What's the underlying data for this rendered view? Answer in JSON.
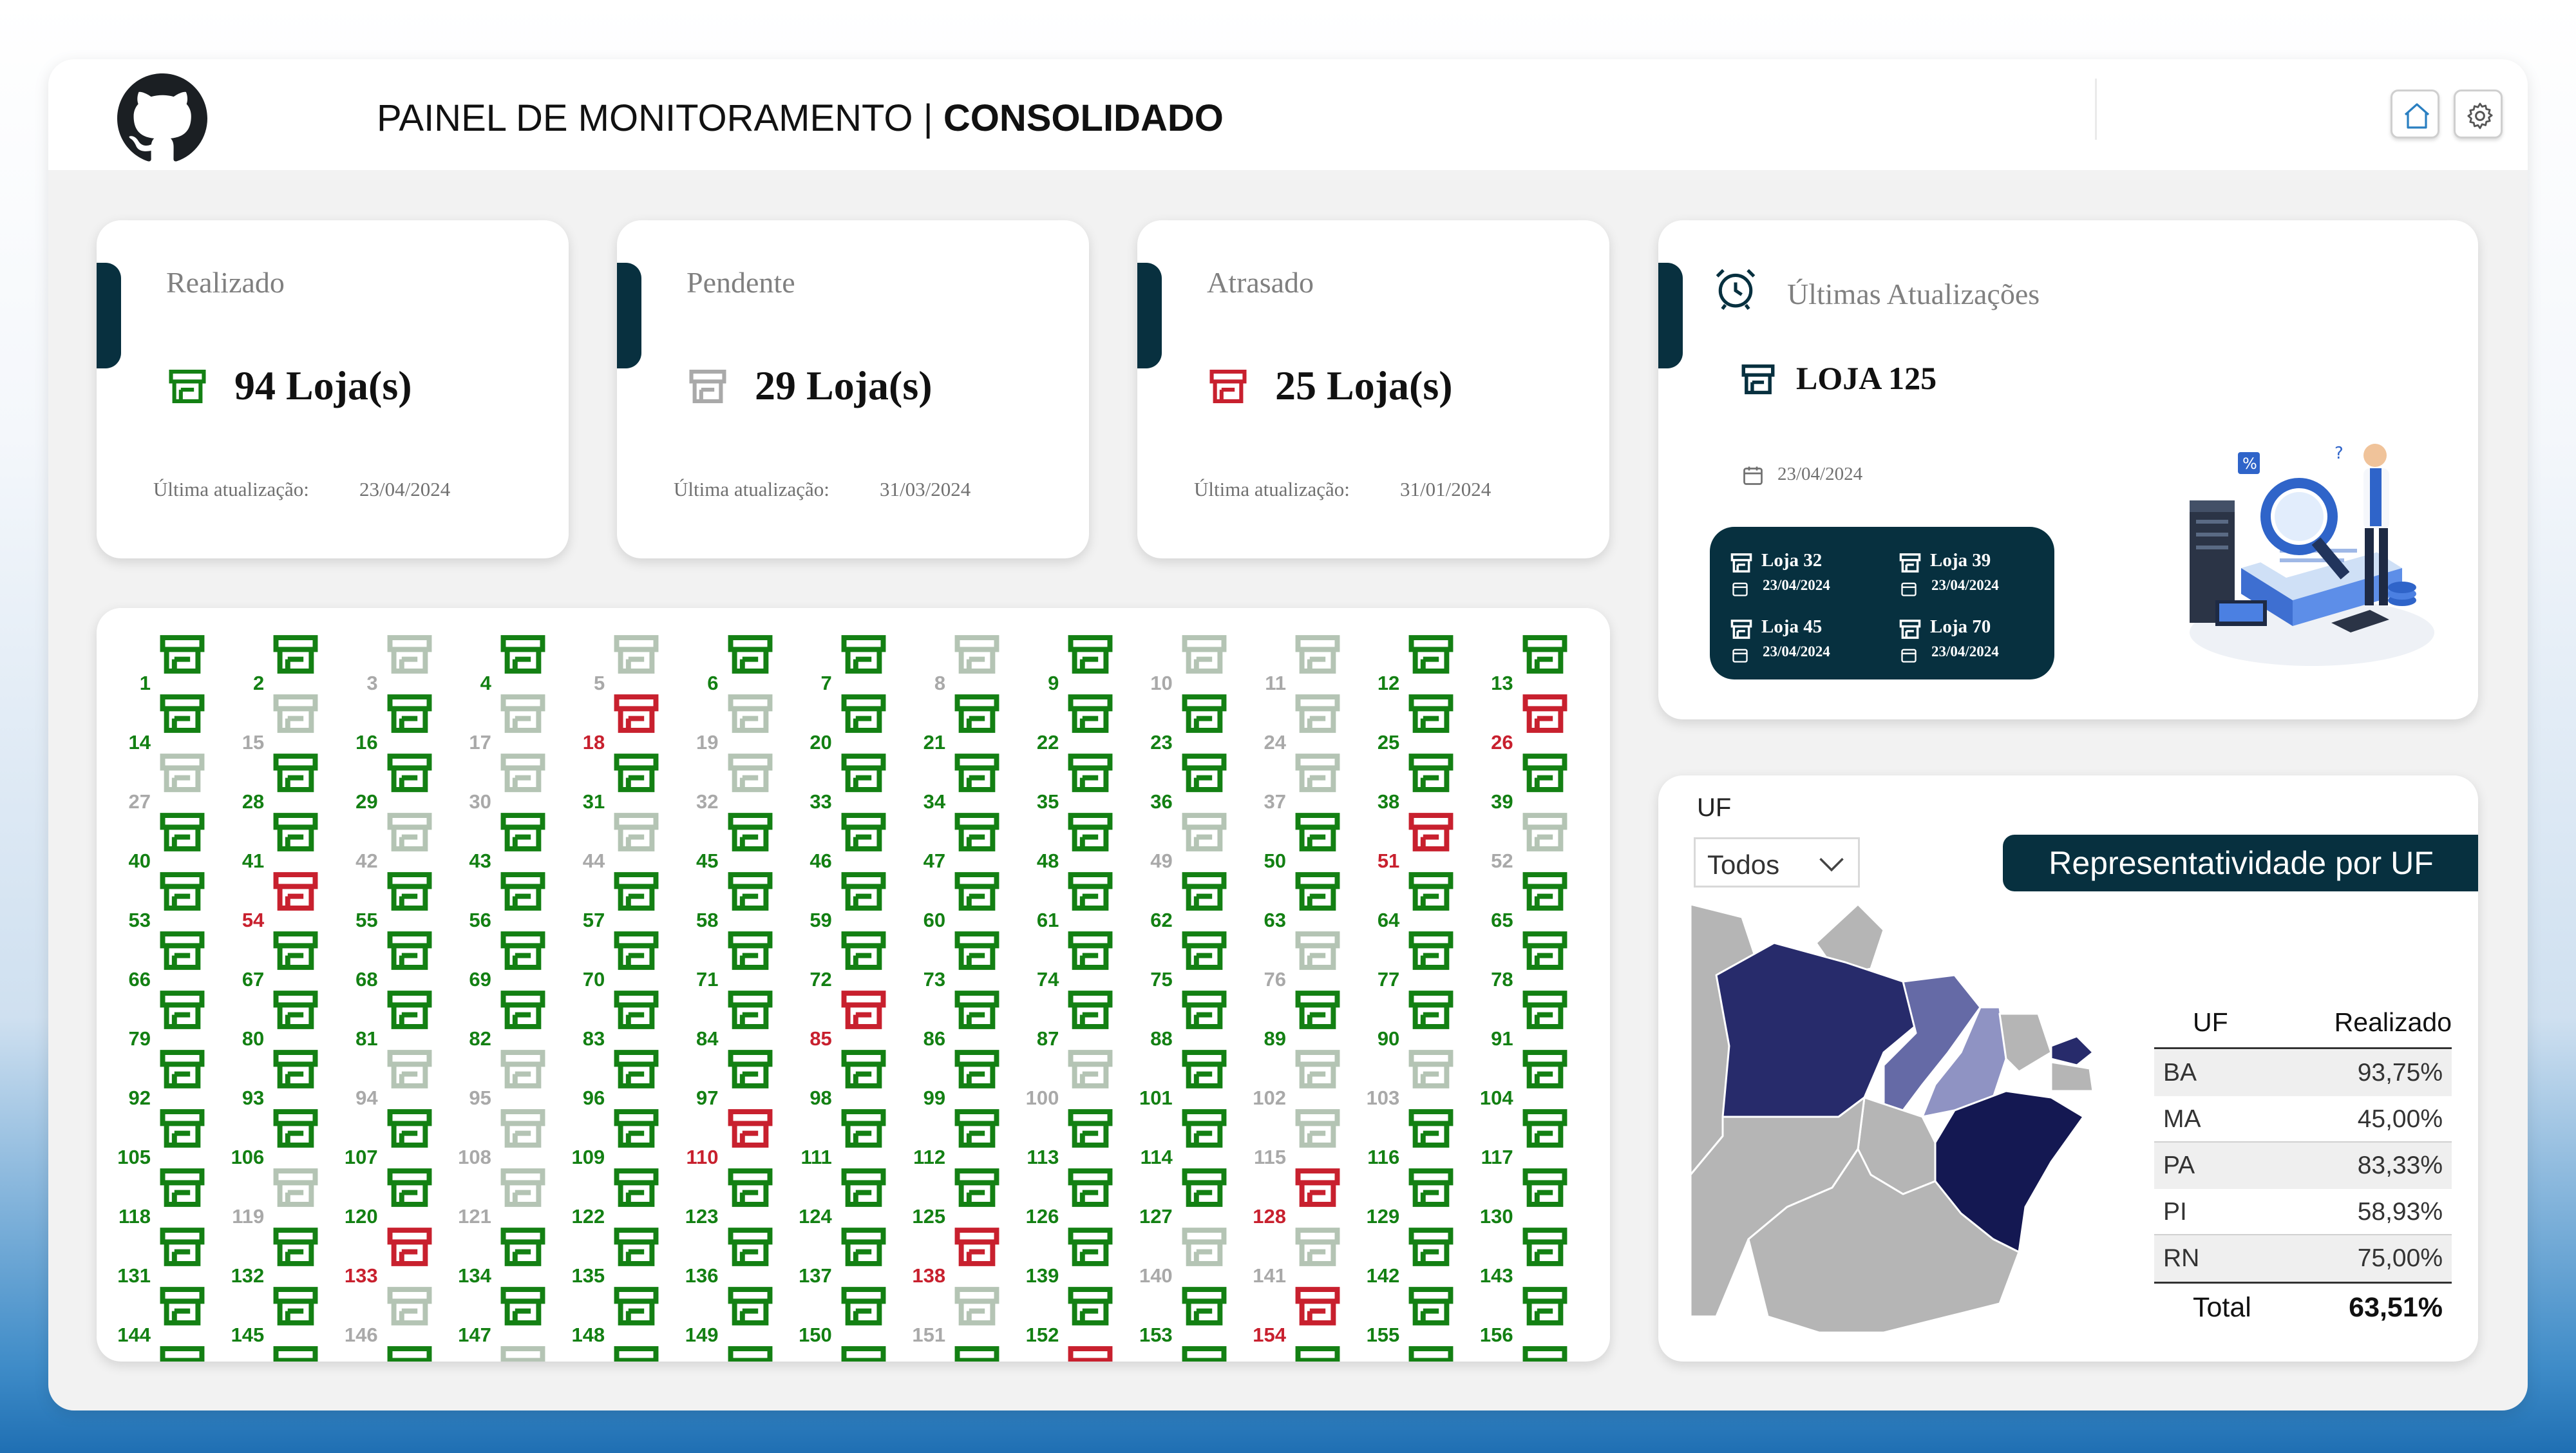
{
  "header": {
    "title_prefix": "PAINEL DE MONITORAMENTO | ",
    "title_bold": "CONSOLIDADO",
    "logo_icon": "github-icon",
    "home_icon": "home-icon",
    "settings_icon": "gear-icon"
  },
  "kpis": [
    {
      "label": "Realizado",
      "value": "94 Loja(s)",
      "footer_label": "Última atualização:",
      "date": "23/04/2024",
      "color": "#138013"
    },
    {
      "label": "Pendente",
      "value": "29 Loja(s)",
      "footer_label": "Última atualização:",
      "date": "31/03/2024",
      "color": "#a9a9a9"
    },
    {
      "label": "Atrasado",
      "value": "25 Loja(s)",
      "footer_label": "Última atualização:",
      "date": "31/01/2024",
      "color": "#c8202e"
    }
  ],
  "updates": {
    "title": "Últimas Atualizações",
    "store": "LOJA 125",
    "date": "23/04/2024",
    "recent": [
      {
        "name": "Loja 32",
        "date": "23/04/2024"
      },
      {
        "name": "Loja 39",
        "date": "23/04/2024"
      },
      {
        "name": "Loja 45",
        "date": "23/04/2024"
      },
      {
        "name": "Loja 70",
        "date": "23/04/2024"
      }
    ]
  },
  "colors": {
    "realizado": "#138013",
    "atrasado": "#c8202e",
    "pendente": "#a9a9a9",
    "navy": "#07303f"
  },
  "stores": {
    "status_legend": {
      "g": "Realizado",
      "r": "Atrasado",
      "p": "Pendente"
    },
    "status": "ggpgpggpgppgggpgprpggggpgrpggpgpggggpggggpgpggggpgrpgrgggggggggggggggggggggpggggggggrggggggggppggggpgppggggpgrggggpgggpgpggggggrggggrggggrgppggggpggggpggrgggggpggggrggggggggggrggrrrr"
  },
  "uf": {
    "label": "UF",
    "selected": "Todos",
    "banner": "Representatividade por UF",
    "table": {
      "headers": [
        "UF",
        "Realizado"
      ],
      "rows": [
        {
          "uf": "BA",
          "value": "93,75%"
        },
        {
          "uf": "MA",
          "value": "45,00%"
        },
        {
          "uf": "PA",
          "value": "83,33%"
        },
        {
          "uf": "PI",
          "value": "58,93%"
        },
        {
          "uf": "RN",
          "value": "75,00%"
        }
      ],
      "total_label": "Total",
      "total_value": "63,51%"
    },
    "map_shading": {
      "PA": "#272b6b",
      "MA": "#656aa6",
      "PI": "#8f93c3",
      "BA": "#141852",
      "RN": "#272b6b",
      "other": "#b5b5b5"
    }
  }
}
